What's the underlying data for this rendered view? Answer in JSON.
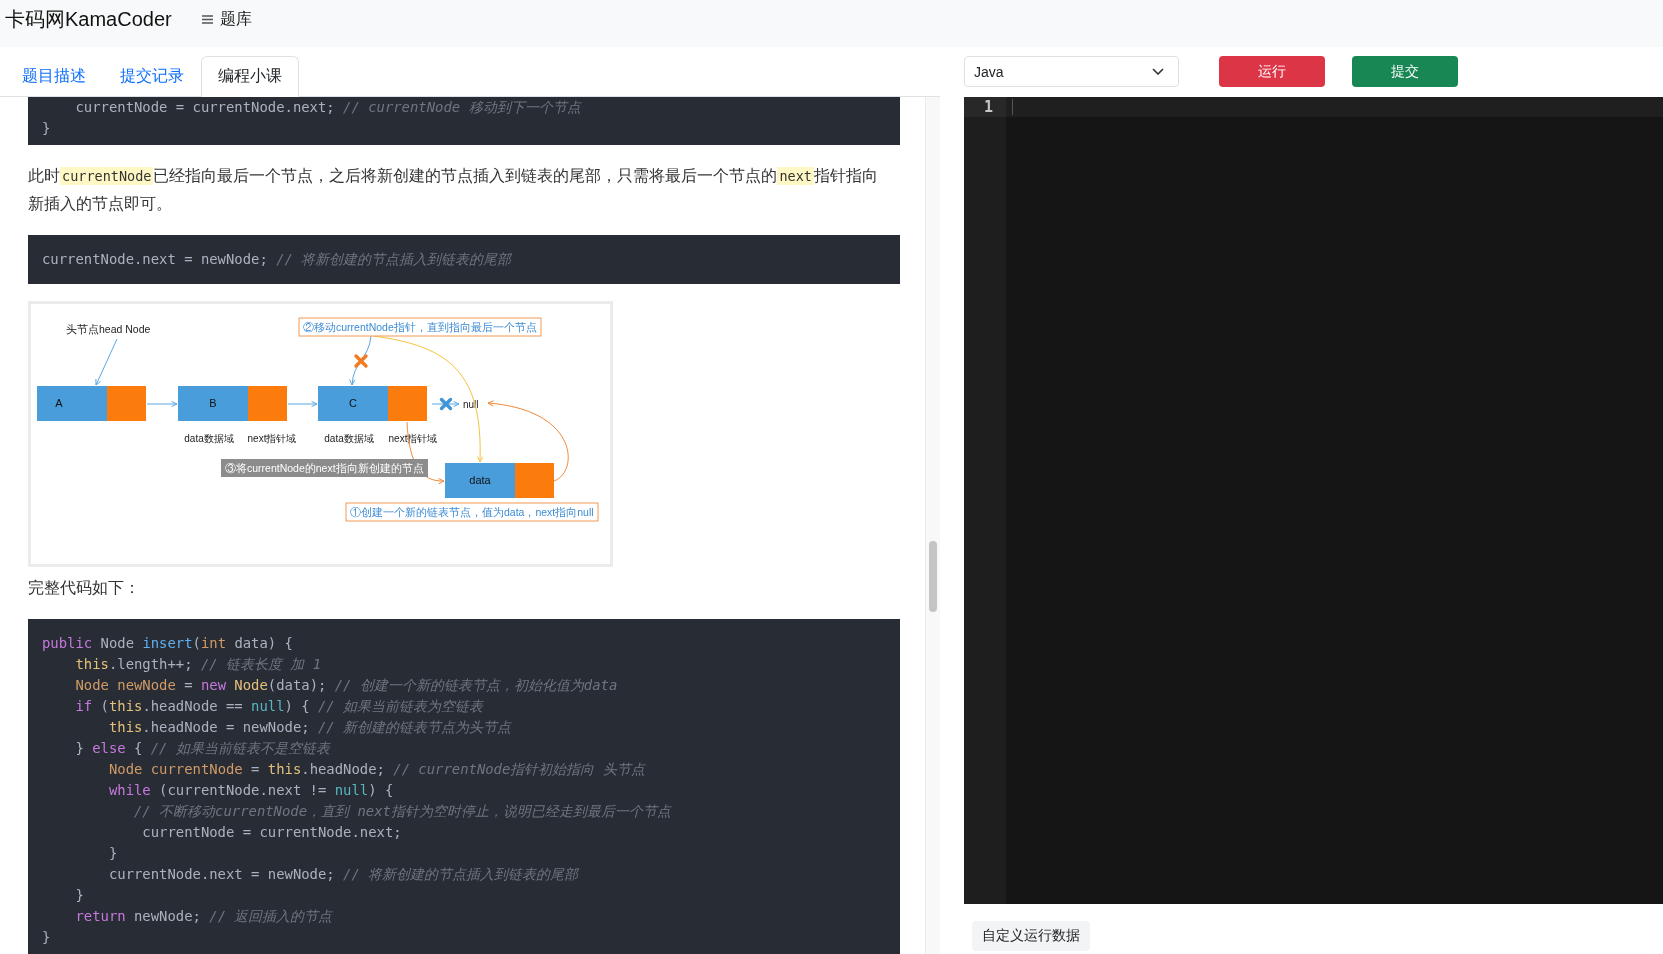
{
  "header": {
    "logo": "卡码网KamaCoder",
    "nav": [
      {
        "label": "题库"
      }
    ]
  },
  "tabs": [
    {
      "label": "题目描述",
      "selected": false
    },
    {
      "label": "提交记录",
      "selected": false
    },
    {
      "label": "编程小课",
      "selected": true
    }
  ],
  "content": [
    {
      "kind": "code",
      "lines": [
        {
          "tokens": [
            {
              "kind": "plain",
              "text": "    currentNode = currentNode.next; "
            },
            {
              "kind": "comment",
              "text": "// currentNode 移动到下一个节点"
            }
          ]
        },
        {
          "tokens": [
            {
              "kind": "plain",
              "text": "}"
            }
          ]
        }
      ]
    },
    {
      "kind": "paragraph",
      "parts": [
        {
          "kind": "text",
          "text": "此时"
        },
        {
          "kind": "code",
          "text": "currentNode"
        },
        {
          "kind": "text",
          "text": "已经指向最后一个节点，之后将新创建的节点插入到链表的尾部，只需将最后一个节点的"
        },
        {
          "kind": "code",
          "text": "next"
        },
        {
          "kind": "text",
          "text": "指针指向新插入的节点即可。"
        }
      ]
    },
    {
      "kind": "code",
      "lines": [
        {
          "tokens": [
            {
              "kind": "plain",
              "text": "currentNode.next = newNode; "
            },
            {
              "kind": "comment",
              "text": "// 将新创建的节点插入到链表的尾部"
            }
          ]
        }
      ]
    },
    {
      "kind": "figure",
      "diagram": {
        "head_label": "头节点head Node",
        "nodes": [
          {
            "label": "A"
          },
          {
            "label": "B"
          },
          {
            "label": "C"
          }
        ],
        "field_labels": [
          {
            "text": "data数据域"
          },
          {
            "text": "next指针域"
          },
          {
            "text": "data数据域"
          },
          {
            "text": "next指针域"
          }
        ],
        "null_label": "null",
        "new_node": {
          "label": "data"
        },
        "callouts": [
          {
            "kind": "outline",
            "text": "②移动currentNode指针，直到指向最后一个节点"
          },
          {
            "kind": "filled",
            "text": "③将currentNode的next指向新创建的节点"
          },
          {
            "kind": "outline",
            "text": "①创建一个新的链表节点，值为data，next指向null"
          }
        ]
      }
    },
    {
      "kind": "paragraph",
      "parts": [
        {
          "kind": "text",
          "text": "完整代码如下："
        }
      ]
    },
    {
      "kind": "code",
      "lines": [
        {
          "tokens": [
            {
              "kind": "keyword",
              "text": "public"
            },
            {
              "kind": "plain",
              "text": " Node "
            },
            {
              "kind": "function",
              "text": "insert"
            },
            {
              "kind": "plain",
              "text": "("
            },
            {
              "kind": "type",
              "text": "int"
            },
            {
              "kind": "plain",
              "text": " data) {"
            }
          ]
        },
        {
          "tokens": [
            {
              "kind": "builtin",
              "text": "    this"
            },
            {
              "kind": "plain",
              "text": ".length++; "
            },
            {
              "kind": "comment",
              "text": "// 链表长度 加 1"
            }
          ]
        },
        {
          "tokens": [
            {
              "kind": "type",
              "text": "    Node"
            },
            {
              "kind": "variable",
              "text": " newNode"
            },
            {
              "kind": "plain",
              "text": " = "
            },
            {
              "kind": "keyword",
              "text": "new"
            },
            {
              "kind": "class",
              "text": " Node"
            },
            {
              "kind": "plain",
              "text": "(data); "
            },
            {
              "kind": "comment",
              "text": "// 创建一个新的链表节点，初始化值为data"
            }
          ]
        },
        {
          "tokens": [
            {
              "kind": "keyword",
              "text": "    if"
            },
            {
              "kind": "plain",
              "text": " ("
            },
            {
              "kind": "builtin",
              "text": "this"
            },
            {
              "kind": "plain",
              "text": ".headNode == "
            },
            {
              "kind": "literal",
              "text": "null"
            },
            {
              "kind": "plain",
              "text": ") { "
            },
            {
              "kind": "comment",
              "text": "// 如果当前链表为空链表"
            }
          ]
        },
        {
          "tokens": [
            {
              "kind": "builtin",
              "text": "        this"
            },
            {
              "kind": "plain",
              "text": ".headNode = newNode; "
            },
            {
              "kind": "comment",
              "text": "// 新创建的链表节点为头节点"
            }
          ]
        },
        {
          "tokens": [
            {
              "kind": "plain",
              "text": "    } "
            },
            {
              "kind": "keyword",
              "text": "else"
            },
            {
              "kind": "plain",
              "text": " { "
            },
            {
              "kind": "comment",
              "text": "// 如果当前链表不是空链表"
            }
          ]
        },
        {
          "tokens": [
            {
              "kind": "type",
              "text": "        Node"
            },
            {
              "kind": "variable",
              "text": " currentNode"
            },
            {
              "kind": "plain",
              "text": " = "
            },
            {
              "kind": "builtin",
              "text": "this"
            },
            {
              "kind": "plain",
              "text": ".headNode; "
            },
            {
              "kind": "comment",
              "text": "// currentNode指针初始指向 头节点"
            }
          ]
        },
        {
          "tokens": [
            {
              "kind": "keyword",
              "text": "        while"
            },
            {
              "kind": "plain",
              "text": " (currentNode.next != "
            },
            {
              "kind": "literal",
              "text": "null"
            },
            {
              "kind": "plain",
              "text": ") {"
            }
          ]
        },
        {
          "tokens": [
            {
              "kind": "comment",
              "text": "           // 不断移动currentNode，直到 next指针为空时停止，说明已经走到最后一个节点"
            }
          ]
        },
        {
          "tokens": [
            {
              "kind": "plain",
              "text": "            currentNode = currentNode.next;"
            }
          ]
        },
        {
          "tokens": [
            {
              "kind": "plain",
              "text": "        }"
            }
          ]
        },
        {
          "tokens": [
            {
              "kind": "plain",
              "text": "        currentNode.next = newNode; "
            },
            {
              "kind": "comment",
              "text": "// 将新创建的节点插入到链表的尾部"
            }
          ]
        },
        {
          "tokens": [
            {
              "kind": "plain",
              "text": "    }"
            }
          ]
        },
        {
          "tokens": [
            {
              "kind": "keyword",
              "text": "    return"
            },
            {
              "kind": "plain",
              "text": " newNode; "
            },
            {
              "kind": "comment",
              "text": "// 返回插入的节点"
            }
          ]
        },
        {
          "tokens": [
            {
              "kind": "plain",
              "text": "}"
            }
          ]
        }
      ]
    }
  ],
  "toolbar": {
    "language": "Java",
    "buttons": [
      {
        "kind": "run",
        "label": "运行"
      },
      {
        "kind": "submit",
        "label": "提交"
      }
    ]
  },
  "editor": {
    "line_numbers": [
      "1"
    ]
  },
  "custom_input_button": "自定义运行数据"
}
